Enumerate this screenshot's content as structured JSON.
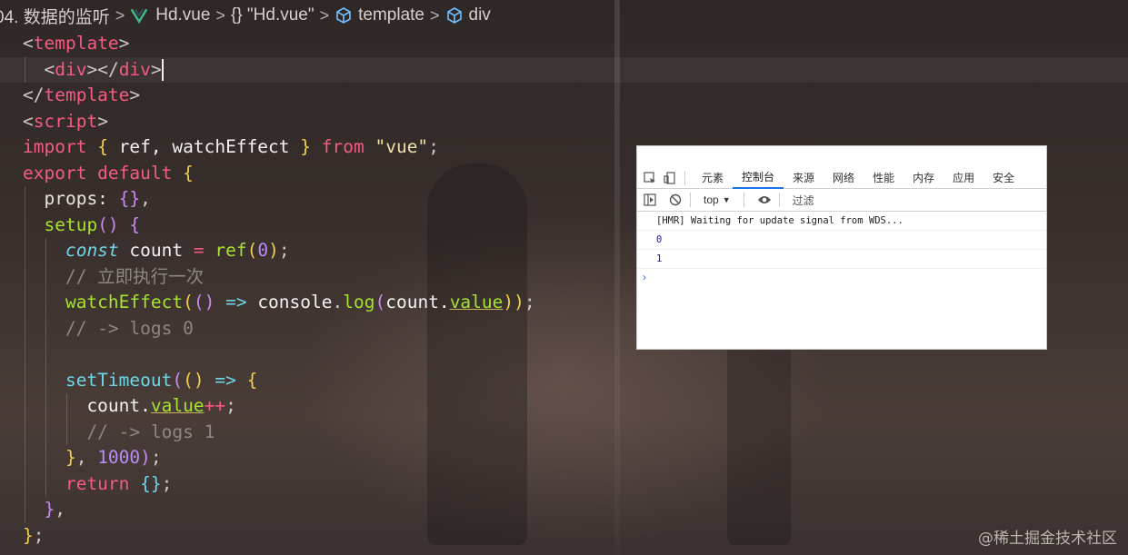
{
  "breadcrumb": {
    "folder": "04. 数据的监听",
    "file": "Hd.vue",
    "module": "{} \"Hd.vue\"",
    "template": "template",
    "div": "div"
  },
  "code": {
    "l1_open": "<",
    "l1_tag": "template",
    "l1_close": ">",
    "l2_indent": "  ",
    "l2_a": "<",
    "l2_tag": "div",
    "l2_b": "></",
    "l2_tag2": "div",
    "l2_c": ">",
    "l3_a": "</",
    "l3_tag": "template",
    "l3_b": ">",
    "l4_a": "<",
    "l4_tag": "script",
    "l4_b": ">",
    "l5_import": "import",
    "l5_ob": " { ",
    "l5_names": "ref, watchEffect",
    "l5_cb": " } ",
    "l5_from": "from",
    "l5_str": " \"vue\"",
    "l5_semi": ";",
    "l6_export": "export default",
    "l6_brace": " {",
    "l7_props": "  props: ",
    "l7_braces": "{}",
    "l7_comma": ",",
    "l8_setup": "  setup",
    "l8_parens": "()",
    "l8_brace": " {",
    "l9_const": "    const",
    "l9_count": " count ",
    "l9_eq": "=",
    "l9_ref": " ref",
    "l9_p1": "(",
    "l9_zero": "0",
    "l9_p2": ")",
    "l9_semi": ";",
    "l10_comment": "    // 立即执行一次",
    "l11_fn": "    watchEffect",
    "l11_p1": "(",
    "l11_p2": "()",
    "l11_arrow": " => ",
    "l11_console": "console",
    "l11_dot": ".",
    "l11_log": "log",
    "l11_p3": "(",
    "l11_count": "count.",
    "l11_value": "value",
    "l11_p4": "))",
    "l11_semi": ";",
    "l12_comment": "    // -> logs 0",
    "l14_fn": "    setTimeout",
    "l14_p1": "(",
    "l14_p2": "()",
    "l14_arrow": " => ",
    "l14_brace": "{",
    "l15_count": "      count.",
    "l15_value": "value",
    "l15_inc": "++",
    "l15_semi": ";",
    "l16_comment": "      // -> logs 1",
    "l17_brace": "    }",
    "l17_comma": ", ",
    "l17_num": "1000",
    "l17_p": ")",
    "l17_semi": ";",
    "l18_return": "    return",
    "l18_braces": " {}",
    "l18_semi": ";",
    "l19_brace": "  }",
    "l19_comma": ",",
    "l20_brace": "}",
    "l20_semi": ";"
  },
  "devtools": {
    "tabs": [
      "元素",
      "控制台",
      "来源",
      "网络",
      "性能",
      "内存",
      "应用",
      "安全"
    ],
    "context": "top",
    "filter_placeholder": "过滤",
    "logs": [
      "[HMR] Waiting for update signal from WDS...",
      "0",
      "1"
    ],
    "prompt": "›"
  },
  "watermark": "@稀土掘金技术社区",
  "icons": {
    "vue": "vue-logo-icon",
    "cube": "symbol-cube-icon",
    "chevron": "chevron-right-icon"
  },
  "colors": {
    "tag": "#f45b83",
    "function": "#a6e22e",
    "string": "#f0e0a8",
    "number": "#b98cf5",
    "comment": "#8d8784",
    "storage": "#6fd6e8",
    "devtools_accent": "#1a73e8"
  }
}
